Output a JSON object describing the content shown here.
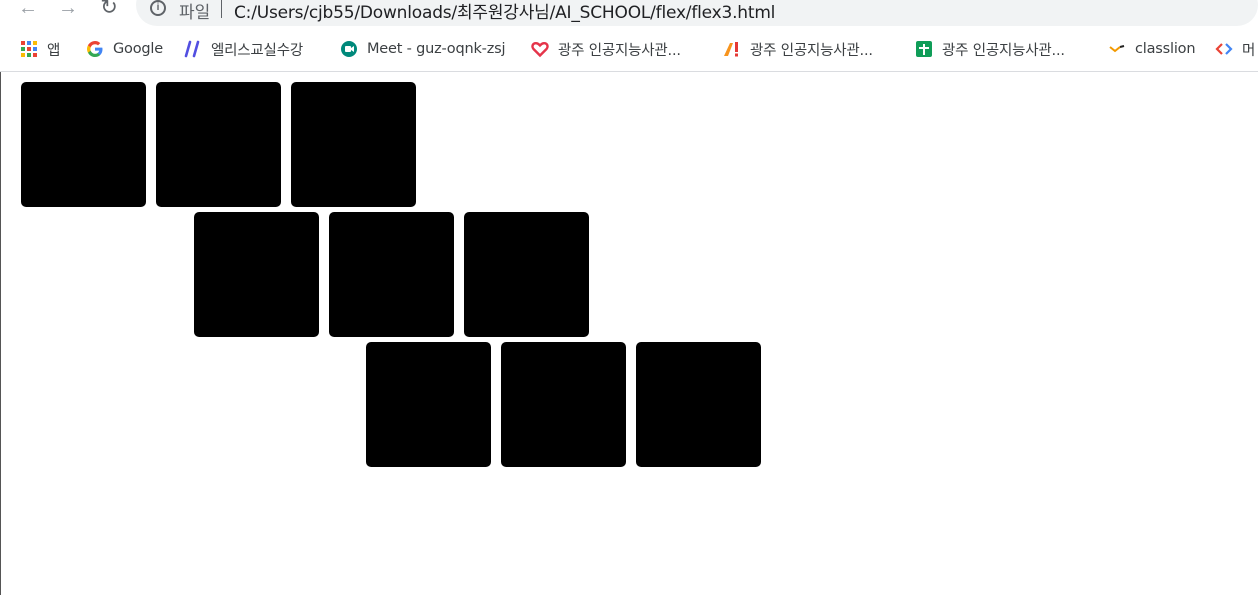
{
  "browser": {
    "nav": {
      "back": "←",
      "forward": "→",
      "reload": "↻"
    },
    "address": {
      "scheme_label": "파일",
      "url": "C:/Users/cjb55/Downloads/최주원강사님/AI_SCHOOL/flex/flex3.html"
    },
    "bookmarks": [
      {
        "label": "앱",
        "icon": "apps-grid-icon"
      },
      {
        "label": "Google",
        "icon": "google-icon"
      },
      {
        "label": "엘리스교실수강",
        "icon": "elice-icon"
      },
      {
        "label": "Meet - guz-oqnk-zsj",
        "icon": "meet-icon"
      },
      {
        "label": "광주 인공지능사관...",
        "icon": "heart-icon"
      },
      {
        "label": "광주 인공지능사관...",
        "icon": "aischool-icon"
      },
      {
        "label": "광주 인공지능사관...",
        "icon": "sheets-icon"
      },
      {
        "label": "classlion",
        "icon": "classlion-icon"
      },
      {
        "label": "머",
        "icon": "code-icon"
      }
    ]
  },
  "page": {
    "rows": [
      {
        "boxes": 3
      },
      {
        "boxes": 3
      },
      {
        "boxes": 3
      }
    ],
    "box_color": "#000000"
  }
}
